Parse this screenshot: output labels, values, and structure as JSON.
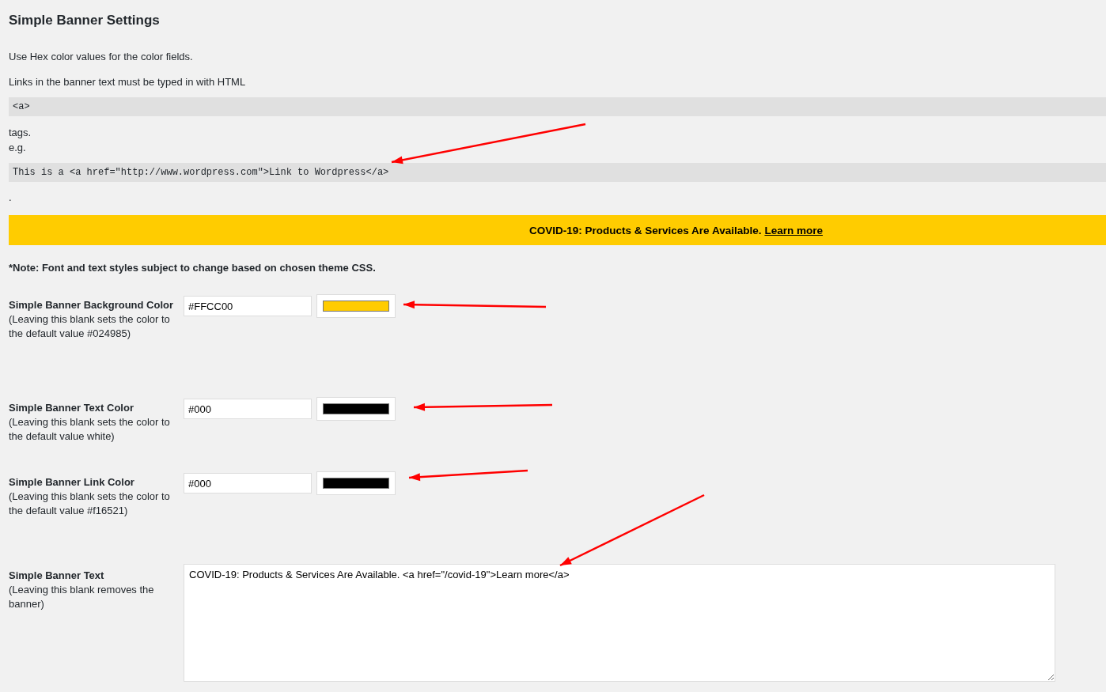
{
  "title": "Simple Banner Settings",
  "intro": [
    "Use Hex color values for the color fields.",
    "Links in the banner text must be typed in with HTML"
  ],
  "code_1": "<a>",
  "after_code": [
    "tags.",
    "e.g."
  ],
  "code_2": "This is a <a href=\"http://www.wordpress.com\">Link to Wordpress</a>",
  "period": ".",
  "banner": {
    "color": "#ffcc00",
    "text": "COVID-19: Products & Services Are Available.",
    "link": "Learn more"
  },
  "note": "*Note: Font and text styles subject to change based on chosen theme CSS.",
  "fields": [
    {
      "kind": "color",
      "label": "Simple Banner Background Color",
      "hint": "(Leaving this blank sets the color to the default value #024985)",
      "value": "#FFCC00",
      "color": "#ffcc00"
    },
    {
      "kind": "color",
      "label": "Simple Banner Text Color",
      "hint": "(Leaving this blank sets the color to the default value white)",
      "value": "#000",
      "color": "#000000"
    },
    {
      "kind": "color",
      "label": "Simple Banner Link Color",
      "hint": "(Leaving this blank sets the color to the default value #f16521)",
      "value": "#000",
      "color": "#000000"
    },
    {
      "kind": "text",
      "label": "Simple Banner Text",
      "hint": "(Leaving this blank removes the banner)",
      "value": "COVID-19: Products & Services Are Available. <a href=\"/covid-19\">Learn more</a>"
    }
  ]
}
